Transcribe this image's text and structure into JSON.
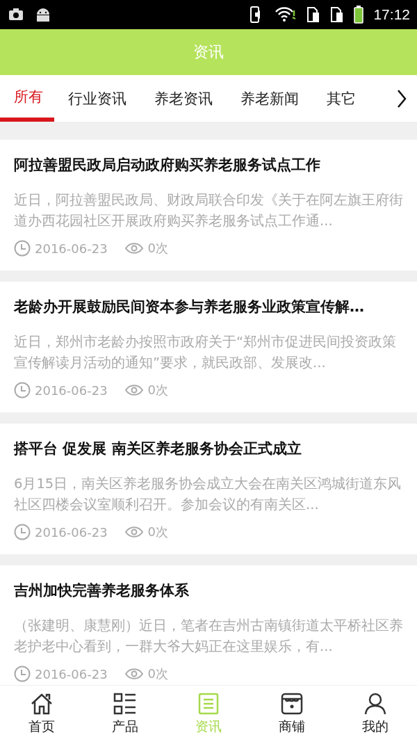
{
  "status_bar": {
    "time": "17:12"
  },
  "header": {
    "title": "资讯"
  },
  "tabs": [
    {
      "label": "所有",
      "selected": true
    },
    {
      "label": "行业资讯",
      "selected": false
    },
    {
      "label": "养老资讯",
      "selected": false
    },
    {
      "label": "养老新闻",
      "selected": false
    },
    {
      "label": "其它",
      "selected": false
    }
  ],
  "articles": [
    {
      "title": "阿拉善盟民政局启动政府购买养老服务试点工作",
      "summary": "近日，阿拉善盟民政局、财政局联合印发《关于在阿左旗王府街道办西花园社区开展政府购买养老服务试点工作通...",
      "date": "2016-06-23",
      "views": "0次"
    },
    {
      "title": "老龄办开展鼓励民间资本参与养老服务业政策宣传解…",
      "summary": "近日，郑州市老龄办按照市政府关于“郑州市促进民间投资政策宣传解读月活动的通知”要求，就民政部、发展改...",
      "date": "2016-06-23",
      "views": "0次"
    },
    {
      "title": "搭平台 促发展 南关区养老服务协会正式成立",
      "summary": "6月15日，南关区养老服务协会成立大会在南关区鸿城街道东风社区四楼会议室顺利召开。参加会议的有南关区...",
      "date": "2016-06-23",
      "views": "0次"
    },
    {
      "title": "吉州加快完善养老服务体系",
      "summary": "（张建明、康慧刚）近日，笔者在吉州古南镇街道太平桥社区养老护老中心看到，一群大爷大妈正在这里娱乐，有...",
      "date": "2016-06-23",
      "views": "0次"
    }
  ],
  "bottom_nav": [
    {
      "kind": "home",
      "label": "首页",
      "selected": false
    },
    {
      "kind": "list",
      "label": "产品",
      "selected": false
    },
    {
      "kind": "news",
      "label": "资讯",
      "selected": true
    },
    {
      "kind": "shop",
      "label": "商铺",
      "selected": false
    },
    {
      "kind": "user",
      "label": "我的",
      "selected": false
    }
  ]
}
